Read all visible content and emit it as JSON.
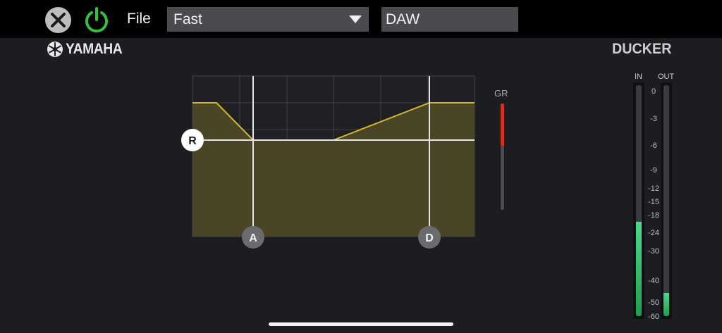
{
  "toolbar": {
    "close_icon": "close-icon",
    "power_icon": "power-icon",
    "power_color": "#35c03a",
    "file_label": "File",
    "preset_value": "Fast",
    "name_value": "DAW"
  },
  "brand": {
    "logo_text": "YAMAHA"
  },
  "module": {
    "title": "DUCKER"
  },
  "graph": {
    "fill_color": "#4a4526",
    "curve_color": "#d1b92a",
    "handles": {
      "range": "R",
      "attack": "A",
      "decay": "D"
    }
  },
  "gr_meter": {
    "label": "GR",
    "level": 0.4,
    "color": "#d2321c"
  },
  "level_meters": {
    "in_label": "IN",
    "out_label": "OUT",
    "in_level": 0.41,
    "out_level": 0.1,
    "scale": [
      "0",
      "-3",
      "-6",
      "-9",
      "-12",
      "-15",
      "-18",
      "-24",
      "-30",
      "-40",
      "-50",
      "-60"
    ]
  }
}
